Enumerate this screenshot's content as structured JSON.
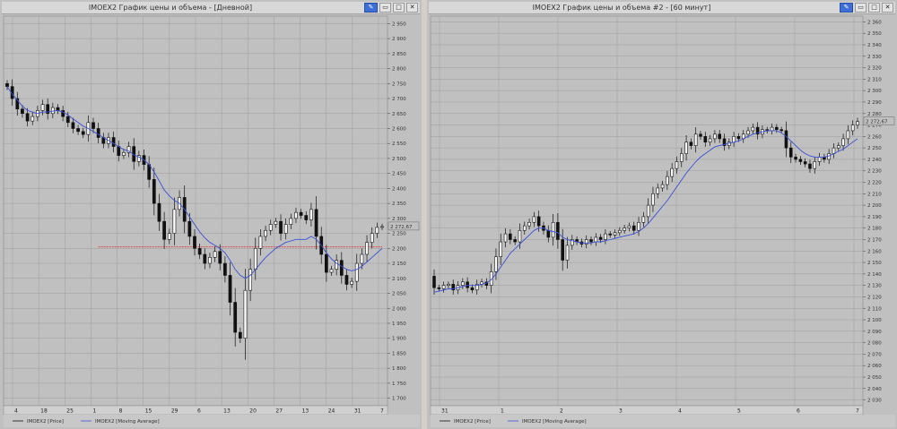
{
  "windows": [
    {
      "title": "IMOEX2 График цены и объема - [Дневной]",
      "buttons": {
        "pin": "✎",
        "min": "▭",
        "max": "□",
        "close": "✕"
      },
      "legend": [
        "IMOEX2 [Price]",
        "IMOEX2 [Moving Average]"
      ],
      "last_price_label": "2 272,67",
      "x_tick_labels": [
        "4",
        "18",
        "25",
        "1",
        "8",
        "15",
        "29",
        "6",
        "13",
        "20",
        "27",
        "13",
        "24",
        "31",
        "7"
      ],
      "y_tick_labels": [
        "1 700",
        "1 750",
        "1 800",
        "1 850",
        "1 900",
        "1 950",
        "2 000",
        "2 050",
        "2 100",
        "2 150",
        "2 200",
        "2 250",
        "2 300",
        "2 350",
        "2 400",
        "2 450",
        "2 500",
        "2 550",
        "2 600",
        "2 650",
        "2 700",
        "2 750",
        "2 800",
        "2 850",
        "2 900",
        "2 950"
      ]
    },
    {
      "title": "IMOEX2 График цены и объема #2 - [60 минут]",
      "buttons": {
        "pin": "✎",
        "min": "▭",
        "max": "□",
        "close": "✕"
      },
      "legend": [
        "IMOEX2 [Price]",
        "IMOEX2 [Moving Average]"
      ],
      "last_price_label": "2 272,67",
      "x_tick_labels": [
        "31",
        "1",
        "2",
        "3",
        "4",
        "5",
        "6",
        "7"
      ],
      "y_tick_labels": [
        "2 030",
        "2 040",
        "2 050",
        "2 060",
        "2 070",
        "2 080",
        "2 090",
        "2 100",
        "2 110",
        "2 120",
        "2 130",
        "2 140",
        "2 150",
        "2 160",
        "2 170",
        "2 180",
        "2 190",
        "2 200",
        "2 210",
        "2 220",
        "2 230",
        "2 240",
        "2 250",
        "2 260",
        "2 270",
        "2 280",
        "2 290",
        "2 300",
        "2 310",
        "2 320",
        "2 330",
        "2 340",
        "2 350",
        "2 360"
      ]
    }
  ],
  "colors": {
    "background": "#c0c0c0",
    "grid": "#9e9e9e",
    "candle": "#111111",
    "moving_average": "#3a4fd8",
    "support_line": "#d83a3a"
  },
  "chart_data": [
    {
      "type": "line",
      "title": "IMOEX2 График цены и объема - [Дневной]",
      "ylim": [
        1675,
        2975
      ],
      "grid": true,
      "legend_position": "bottom-left",
      "horizontal_line": 2205,
      "series": [
        {
          "name": "IMOEX2 [Price]",
          "values": [
            2740,
            2700,
            2665,
            2650,
            2625,
            2640,
            2660,
            2680,
            2650,
            2670,
            2660,
            2640,
            2620,
            2600,
            2590,
            2580,
            2620,
            2600,
            2570,
            2550,
            2570,
            2540,
            2510,
            2520,
            2540,
            2490,
            2510,
            2480,
            2430,
            2350,
            2290,
            2230,
            2250,
            2330,
            2370,
            2290,
            2240,
            2200,
            2180,
            2150,
            2170,
            2190,
            2150,
            2110,
            2020,
            1920,
            1900,
            2060,
            2130,
            2200,
            2240,
            2260,
            2280,
            2290,
            2250,
            2280,
            2300,
            2320,
            2310,
            2295,
            2330,
            2240,
            2180,
            2120,
            2130,
            2160,
            2110,
            2080,
            2090,
            2150,
            2180,
            2220,
            2250,
            2270,
            2273
          ]
        },
        {
          "name": "IMOEX2 [Moving Average]",
          "values": [
            2740,
            2715,
            2695,
            2675,
            2660,
            2655,
            2650,
            2655,
            2655,
            2658,
            2660,
            2655,
            2645,
            2632,
            2620,
            2608,
            2600,
            2590,
            2580,
            2570,
            2560,
            2550,
            2540,
            2530,
            2525,
            2512,
            2505,
            2495,
            2480,
            2455,
            2425,
            2395,
            2375,
            2360,
            2350,
            2330,
            2305,
            2280,
            2255,
            2235,
            2220,
            2210,
            2200,
            2185,
            2160,
            2130,
            2110,
            2100,
            2110,
            2130,
            2150,
            2170,
            2185,
            2200,
            2210,
            2220,
            2225,
            2230,
            2230,
            2230,
            2240,
            2230,
            2210,
            2185,
            2165,
            2150,
            2140,
            2130,
            2125,
            2130,
            2140,
            2155,
            2170,
            2185,
            2200
          ]
        }
      ]
    },
    {
      "type": "line",
      "title": "IMOEX2 График цены и объема #2 - [60 минут]",
      "ylim": [
        2025,
        2365
      ],
      "grid": true,
      "legend_position": "bottom-left",
      "series": [
        {
          "name": "IMOEX2 [Price]",
          "values": [
            2128,
            2127,
            2130,
            2131,
            2126,
            2130,
            2133,
            2128,
            2126,
            2131,
            2133,
            2130,
            2142,
            2155,
            2168,
            2175,
            2170,
            2168,
            2178,
            2182,
            2185,
            2190,
            2182,
            2178,
            2172,
            2185,
            2170,
            2152,
            2165,
            2170,
            2168,
            2166,
            2170,
            2168,
            2172,
            2170,
            2175,
            2174,
            2176,
            2178,
            2180,
            2182,
            2178,
            2185,
            2190,
            2200,
            2210,
            2215,
            2218,
            2225,
            2232,
            2238,
            2245,
            2255,
            2252,
            2262,
            2260,
            2255,
            2258,
            2262,
            2258,
            2252,
            2255,
            2260,
            2258,
            2262,
            2265,
            2268,
            2262,
            2266,
            2265,
            2268,
            2266,
            2265,
            2250,
            2242,
            2240,
            2238,
            2236,
            2232,
            2238,
            2242,
            2240,
            2245,
            2250,
            2252,
            2258,
            2265,
            2270,
            2273
          ]
        },
        {
          "name": "IMOEX2 [Moving Average]",
          "values": [
            2124,
            2125,
            2126,
            2127,
            2127,
            2128,
            2129,
            2130,
            2130,
            2130,
            2131,
            2132,
            2135,
            2140,
            2146,
            2152,
            2158,
            2162,
            2166,
            2170,
            2174,
            2178,
            2180,
            2180,
            2178,
            2177,
            2176,
            2172,
            2170,
            2169,
            2168,
            2167,
            2167,
            2167,
            2168,
            2168,
            2169,
            2170,
            2171,
            2172,
            2173,
            2174,
            2175,
            2177,
            2180,
            2184,
            2189,
            2194,
            2199,
            2204,
            2210,
            2216,
            2222,
            2228,
            2233,
            2238,
            2242,
            2245,
            2248,
            2251,
            2252,
            2253,
            2254,
            2255,
            2256,
            2258,
            2260,
            2262,
            2263,
            2264,
            2265,
            2265,
            2265,
            2263,
            2260,
            2256,
            2252,
            2248,
            2245,
            2243,
            2242,
            2242,
            2242,
            2243,
            2245,
            2247,
            2249,
            2252,
            2255,
            2258
          ]
        }
      ]
    }
  ]
}
